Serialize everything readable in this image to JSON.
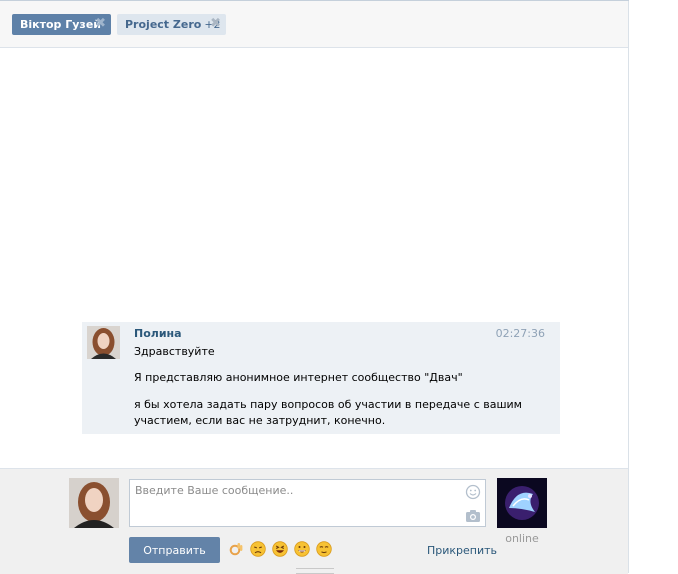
{
  "tabs": [
    {
      "label": "Віктор Гузей",
      "extra": "",
      "active": true,
      "close_icon": "close-icon"
    },
    {
      "label": "Project Zero",
      "extra": "+2",
      "active": false,
      "close_icon": "close-icon"
    }
  ],
  "message": {
    "author": "Полина",
    "time": "02:27:36",
    "lines": [
      "Здравствуйте",
      "Я представляю анонимное интернет сообщество \"Двач\"",
      "я бы хотела задать пару вопросов об участии в передаче с вашим",
      "участием, если вас не затруднит, конечно."
    ]
  },
  "composer": {
    "placeholder": "Введите Ваше сообщение..",
    "send_label": "Отправить",
    "attach_label": "Прикрепить",
    "peer_status": "online",
    "emoji_icons": [
      "ok-hand-icon",
      "disappointed-face-icon",
      "laughing-face-icon",
      "grinning-face-icon",
      "relieved-face-icon"
    ]
  },
  "colors": {
    "accent": "#5e81a8",
    "link": "#2b587a",
    "message_bg": "#edf1f5"
  }
}
